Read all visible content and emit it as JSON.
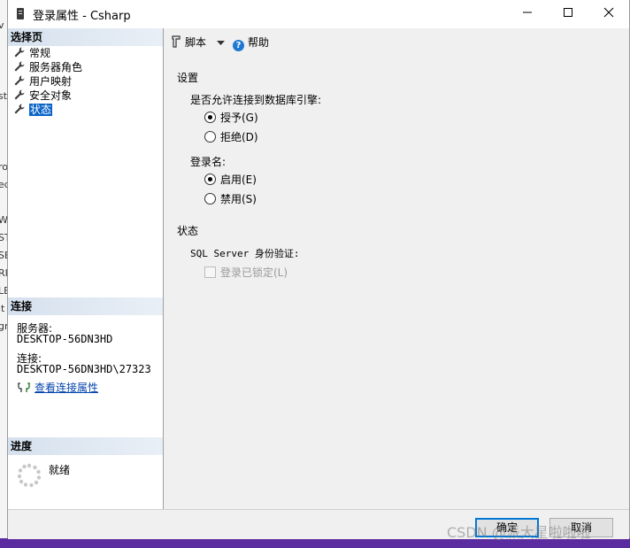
{
  "window": {
    "title": "登录属性 - Csharp"
  },
  "background_fragments": [
    "v",
    "st",
    "ro",
    "ed",
    "W",
    "ST",
    "SE",
    "RI",
    "LE",
    "it",
    "gr"
  ],
  "sidebar": {
    "select_page_header": "选择页",
    "items": [
      {
        "label": "常规",
        "selected": false
      },
      {
        "label": "服务器角色",
        "selected": false
      },
      {
        "label": "用户映射",
        "selected": false
      },
      {
        "label": "安全对象",
        "selected": false
      },
      {
        "label": "状态",
        "selected": true
      }
    ],
    "connection": {
      "header": "连接",
      "server_label": "服务器:",
      "server_value": "DESKTOP-56DN3HD",
      "conn_label": "连接:",
      "conn_value": "DESKTOP-56DN3HD\\27323",
      "link": "查看连接属性"
    },
    "progress": {
      "header": "进度",
      "status": "就绪"
    }
  },
  "toolbar": {
    "script_label": "脚本",
    "help_label": "帮助"
  },
  "settings": {
    "header": "设置",
    "db_engine_question": "是否允许连接到数据库引擎:",
    "grant": "授予(G)",
    "deny": "拒绝(D)",
    "login_label": "登录名:",
    "enable": "启用(E)",
    "disable": "禁用(S)",
    "permission": "grant",
    "login_state": "enable"
  },
  "status": {
    "header": "状态",
    "auth_label": "SQL Server 身份验证:",
    "locked_label": "登录已锁定(L)",
    "locked": false
  },
  "footer": {
    "ok_label": "确定",
    "cancel_label": "取消"
  },
  "watermark": "CSDN @派大星啦啦啦"
}
